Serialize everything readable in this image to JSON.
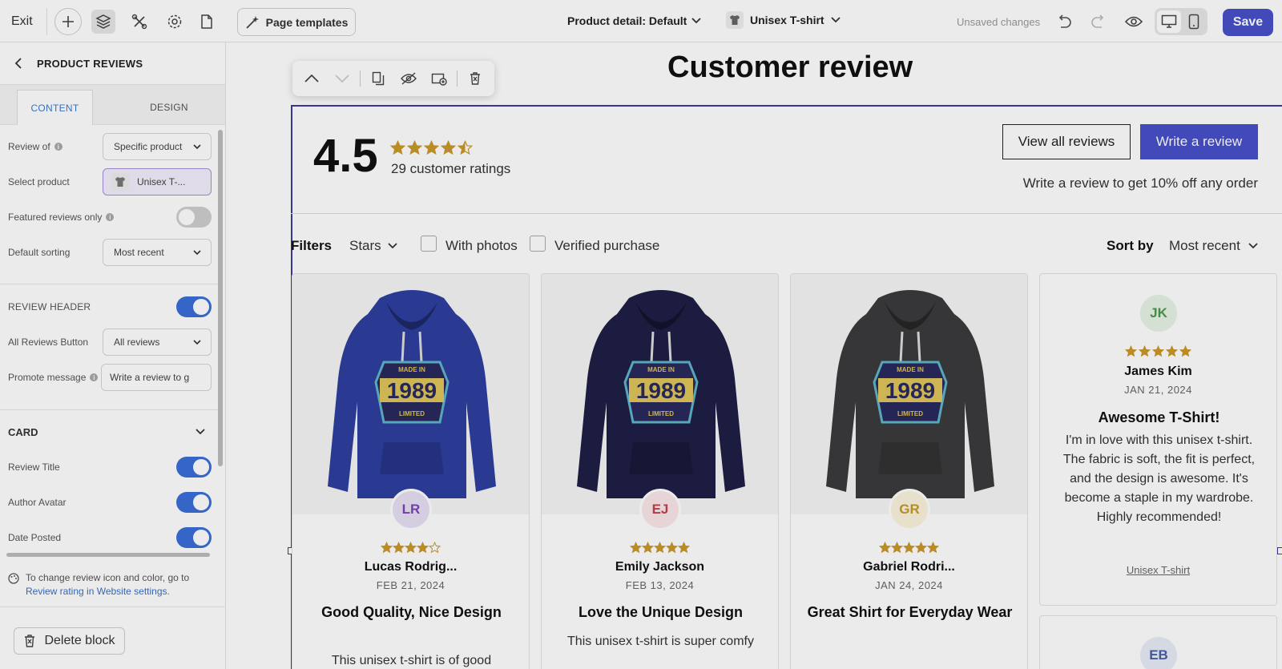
{
  "topbar": {
    "exit": "Exit",
    "page_templates": "Page templates",
    "page_select": "Product detail: Default",
    "product_select": "Unisex T-shirt",
    "status": "Unsaved changes",
    "save": "Save"
  },
  "panel": {
    "title": "PRODUCT REVIEWS",
    "tabs": [
      "CONTENT",
      "DESIGN"
    ],
    "fields": {
      "review_of": {
        "label": "Review of",
        "value": "Specific product"
      },
      "select_product": {
        "label": "Select product",
        "value": "Unisex T-..."
      },
      "featured_only": {
        "label": "Featured reviews only",
        "on": false
      },
      "default_sorting": {
        "label": "Default sorting",
        "value": "Most recent"
      },
      "review_header": {
        "label": "REVIEW HEADER",
        "on": true
      },
      "all_reviews_button": {
        "label": "All Reviews Button",
        "value": "All reviews"
      },
      "promote_message": {
        "label": "Promote message",
        "value": "Write a review to g"
      }
    },
    "card_section": "CARD",
    "card_toggles": [
      {
        "label": "Review Title",
        "on": true
      },
      {
        "label": "Author Avatar",
        "on": true
      },
      {
        "label": "Date Posted",
        "on": true
      }
    ],
    "note_text": "To change review icon and color, go to",
    "note_link": "Review rating in Website settings.",
    "delete_block": "Delete block"
  },
  "canvas": {
    "heading": "Customer review",
    "score": "4.5",
    "score_stars": 4.5,
    "ratings_count": "29 customer ratings",
    "view_all": "View all reviews",
    "write_review": "Write a review",
    "promo": "Write a review to get 10% off any order",
    "filters_label": "Filters",
    "stars_filter": "Stars",
    "with_photos": "With photos",
    "verified": "Verified purchase",
    "sort_label": "Sort by",
    "sort_value": "Most recent"
  },
  "reviews": [
    {
      "initials": "LR",
      "avatar_bg": "#e8e0f5",
      "avatar_fg": "#7b45b8",
      "rating": 4,
      "name": "Lucas Rodrig...",
      "date": "FEB 21, 2024",
      "title": "Good Quality, Nice Design",
      "body": "This unisex t-shirt is of good",
      "hoodie_color": "#2e3fa0"
    },
    {
      "initials": "EJ",
      "avatar_bg": "#fbe7e9",
      "avatar_fg": "#c0404e",
      "rating": 5,
      "name": "Emily Jackson",
      "date": "FEB 13, 2024",
      "title": "Love the Unique Design",
      "body": "This unisex t-shirt is super comfy",
      "hoodie_color": "#1e1f45"
    },
    {
      "initials": "GR",
      "avatar_bg": "#fbf3dc",
      "avatar_fg": "#c49a2a",
      "rating": 5,
      "name": "Gabriel Rodri...",
      "date": "JAN 24, 2024",
      "title": "Great Shirt for Everyday Wear",
      "body": "",
      "hoodie_color": "#3b3b3e"
    }
  ],
  "text_review": {
    "initials": "JK",
    "avatar_bg": "#e6f4e6",
    "avatar_fg": "#4a9a4a",
    "rating": 5,
    "name": "James Kim",
    "date": "JAN 21, 2024",
    "title": "Awesome T-Shirt!",
    "body": "I'm in love with this unisex t-shirt. The fabric is soft, the fit is perfect, and the design is awesome. It's become a staple in my wardrobe. Highly recommended!",
    "product_link": "Unisex T-shirt"
  },
  "next_review": {
    "initials": "EB"
  },
  "colors": {
    "accent": "#4850c9",
    "star": "#c9982a",
    "toggle_on": "#3a6fd8",
    "selection": "#3d3a9e"
  }
}
